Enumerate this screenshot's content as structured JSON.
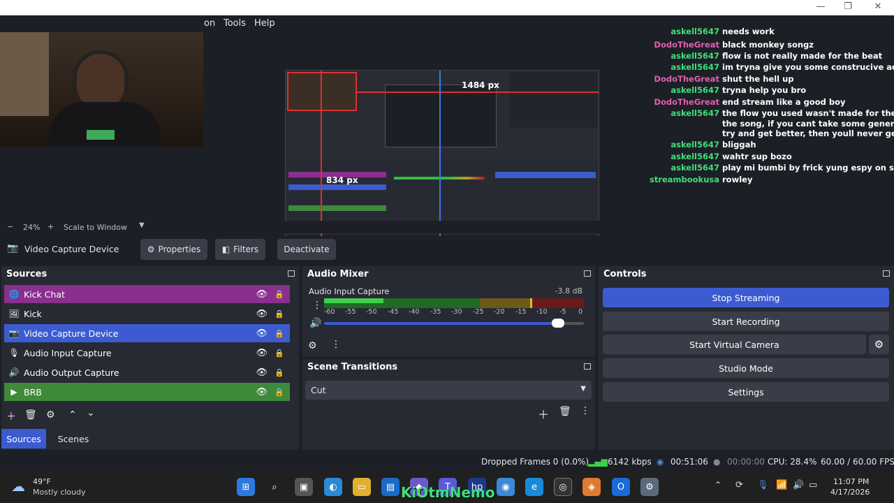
{
  "window": {
    "menu": [
      "on",
      "Tools",
      "Help"
    ],
    "controls": [
      "—",
      "❐",
      "✕"
    ]
  },
  "chat": [
    {
      "user": "askell5647",
      "msg": "needs work",
      "color": "#3fe07a"
    },
    {
      "user": "DodoTheGreat",
      "msg": "black monkey songz",
      "color": "#e05fae"
    },
    {
      "user": "askell5647",
      "msg": "flow is not really made for the beat",
      "color": "#3fe07a"
    },
    {
      "user": "askell5647",
      "msg": "im tryna give you some construcive advice",
      "color": "#3fe07a"
    },
    {
      "user": "DodoTheGreat",
      "msg": "shut the hell up",
      "color": "#e05fae"
    },
    {
      "user": "askell5647",
      "msg": "tryna help you bro",
      "color": "#3fe07a"
    },
    {
      "user": "DodoTheGreat",
      "msg": "end stream like a good boy",
      "color": "#e05fae"
    },
    {
      "user": "askell5647",
      "msg": "the flow you used wasn't made for the beat use",
      "color": "#3fe07a"
    },
    {
      "user": "",
      "msg": "the song, if you cant take some general advice",
      "color": "#3fe07a"
    },
    {
      "user": "",
      "msg": "try and get better, then youll never get better",
      "color": "#3fe07a"
    },
    {
      "user": "askell5647",
      "msg": "bliggah",
      "color": "#3fe07a"
    },
    {
      "user": "askell5647",
      "msg": "wahtr sup bozo",
      "color": "#3fe07a"
    },
    {
      "user": "askell5647",
      "msg": "play mi bumbi by frick yung espy on soundclou",
      "color": "#3fe07a"
    },
    {
      "user": "streambookusa",
      "msg": "rowley",
      "color": "#3fe07a"
    }
  ],
  "preview": {
    "width_label": "1484 px",
    "height_label": "834 px"
  },
  "zoom": {
    "minus": "−",
    "value": "24%",
    "plus": "+",
    "mode": "Scale to Window"
  },
  "context": {
    "source_name": "Video Capture Device",
    "properties": "Properties",
    "filters": "Filters",
    "deactivate": "Deactivate"
  },
  "sources": {
    "title": "Sources",
    "items": [
      {
        "label": "Kick Chat",
        "icon": "globe-icon",
        "glyph": "🌐",
        "bg": "#8a2f8e"
      },
      {
        "label": "Kick",
        "icon": "image-icon",
        "glyph": "🖼",
        "bg": "transparent"
      },
      {
        "label": "Video Capture Device",
        "icon": "camera-icon",
        "glyph": "📷",
        "bg": "#3c5bd1"
      },
      {
        "label": "Audio Input Capture",
        "icon": "microphone-icon",
        "glyph": "🎙",
        "bg": "transparent"
      },
      {
        "label": "Audio Output Capture",
        "icon": "speaker-icon",
        "glyph": "🔊",
        "bg": "transparent"
      },
      {
        "label": "BRB",
        "icon": "play-icon",
        "glyph": "▶",
        "bg": "#3f8a3a"
      }
    ],
    "tab_sources": "Sources",
    "tab_scenes": "Scenes"
  },
  "mixer": {
    "title": "Audio Mixer",
    "channel": "Audio Input Capture",
    "level": "-3.8 dB",
    "ticks": [
      "-60",
      "-55",
      "-50",
      "-45",
      "-40",
      "-35",
      "-30",
      "-25",
      "-20",
      "-15",
      "-10",
      "-5",
      "0"
    ],
    "volume_fraction": 0.9
  },
  "transitions": {
    "title": "Scene Transitions",
    "selected": "Cut"
  },
  "controls": {
    "title": "Controls",
    "stop_streaming": "Stop Streaming",
    "start_recording": "Start Recording",
    "start_virtual_camera": "Start Virtual Camera",
    "studio_mode": "Studio Mode",
    "settings": "Settings",
    "accent": "#3c5bd1"
  },
  "status": {
    "dropped": "Dropped Frames 0 (0.0%)",
    "bitrate": "6142 kbps",
    "stream_time": "00:51:06",
    "rec_time": "00:00:00",
    "cpu": "CPU: 28.4%",
    "fps": "60.00 / 60.00 FPS"
  },
  "taskbar": {
    "temp": "49°F",
    "weather": "Mostly cloudy",
    "watermark": "KiOtmNemo",
    "time": "11:07 PM",
    "date": "4/17/2026"
  }
}
